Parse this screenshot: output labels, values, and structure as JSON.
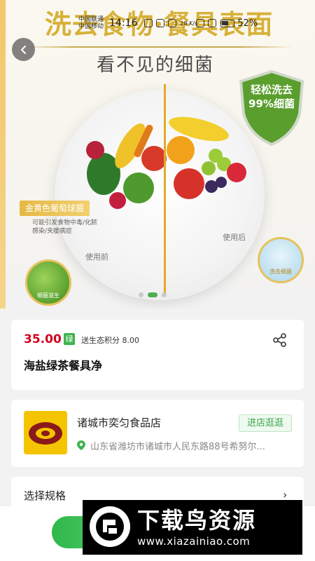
{
  "status_bar": {
    "carrier_1": "中国联通",
    "carrier_2": "中国移动",
    "time": "14:16",
    "speed": "28 K/s",
    "battery": "52%"
  },
  "hero": {
    "title": "洗去食物·餐具表面",
    "subtitle": "看不见的细菌",
    "shield_text_1": "轻松洗去",
    "shield_text_2": "99%细菌",
    "badge_left": "金黄色葡萄球菌",
    "badge_left_note": "可能引发食物中毒/化脓感染/夹瘘病症",
    "use_before": "使用前",
    "use_after": "使用后",
    "before_label": "细菌滋生",
    "after_label": "洗去细菌",
    "carousel_pages": 3,
    "carousel_active": 2
  },
  "product": {
    "price": "35.00",
    "green_tag": "绿",
    "eco_points": "送生态积分 8.00",
    "name": "海盐绿茶餐具净"
  },
  "store": {
    "name": "诸城市奕匀食品店",
    "visit_label": "进店逛逛",
    "address": "山东省潍坊市诸城市人民东路88号希努尔..."
  },
  "spec": {
    "label": "选择规格",
    "chevron": "›"
  },
  "watermark": {
    "title": "下载鸟资源",
    "url": "www.xiazainiao.com"
  },
  "colors": {
    "accent_green": "#3fb34f",
    "price_red": "#d0021b",
    "hero_gold": "#d7b13a"
  }
}
